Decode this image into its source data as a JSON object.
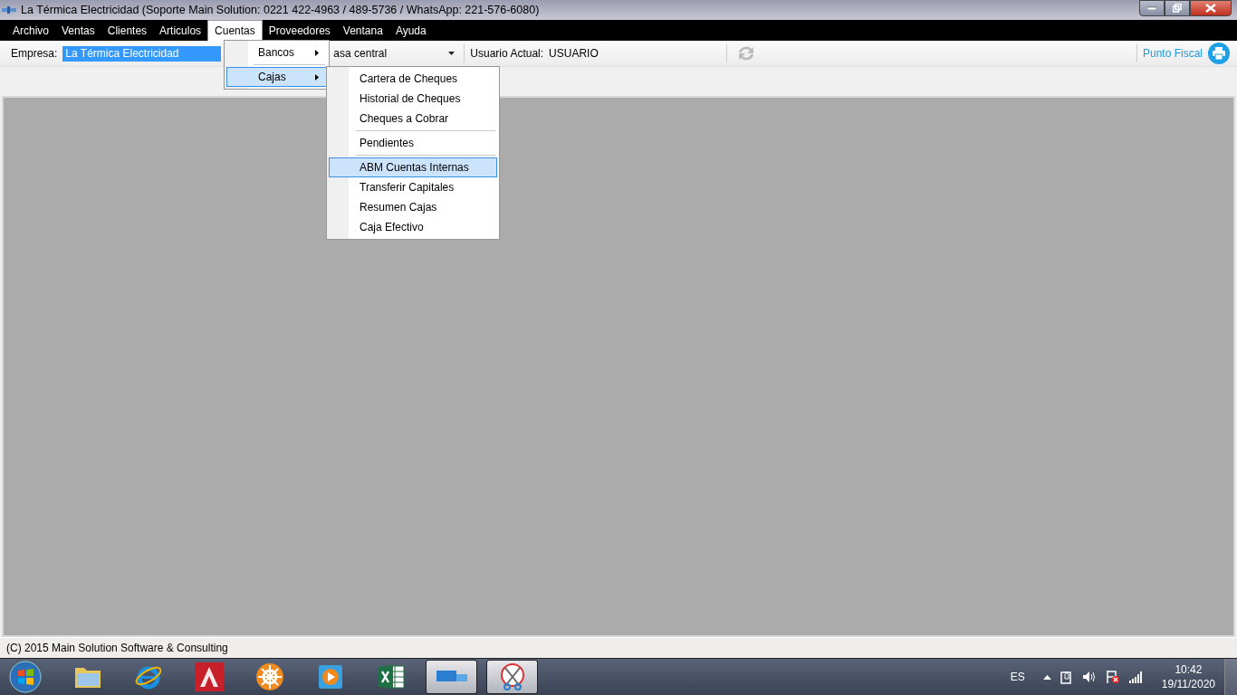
{
  "window": {
    "title": "La Térmica Electricidad (Soporte Main Solution: 0221 422-4963 / 489-5736 / WhatsApp: 221-576-6080)"
  },
  "menu": [
    {
      "label": "Archivo",
      "selected": false
    },
    {
      "label": "Ventas",
      "selected": false
    },
    {
      "label": "Clientes",
      "selected": false
    },
    {
      "label": "Articulos",
      "selected": false
    },
    {
      "label": "Cuentas",
      "selected": true
    },
    {
      "label": "Proveedores",
      "selected": false
    },
    {
      "label": "Ventana",
      "selected": false
    },
    {
      "label": "Ayuda",
      "selected": false
    }
  ],
  "toolbar": {
    "empresa_label": "Empresa:",
    "empresa_value": "La Térmica Electricidad",
    "sucursal_value": "asa central",
    "usuario_label": "Usuario Actual:",
    "usuario_value": "USUARIO",
    "punto_fiscal": "Punto Fiscal"
  },
  "cuentas_menu": [
    {
      "label": "Bancos",
      "selected": false
    },
    {
      "label": "Cajas",
      "selected": true
    }
  ],
  "cajas_menu": [
    {
      "label": "Cartera de Cheques",
      "selected": false,
      "separator_before": false
    },
    {
      "label": "Historial de Cheques",
      "selected": false,
      "separator_before": false
    },
    {
      "label": "Cheques a Cobrar",
      "selected": false,
      "separator_before": false
    },
    {
      "label": "Pendientes",
      "selected": false,
      "separator_before": true
    },
    {
      "label": "ABM Cuentas Internas",
      "selected": true,
      "separator_before": true
    },
    {
      "label": "Transferir Capitales",
      "selected": false,
      "separator_before": false
    },
    {
      "label": "Resumen Cajas",
      "selected": false,
      "separator_before": false
    },
    {
      "label": "Caja Efectivo",
      "selected": false,
      "separator_before": false
    }
  ],
  "status_bar": "(C) 2015 Main Solution Software & Consulting",
  "taskbar": {
    "apps": [
      {
        "kind": "folder",
        "selected": false
      },
      {
        "kind": "browser",
        "selected": false
      },
      {
        "kind": "cad",
        "selected": false
      },
      {
        "kind": "wheel",
        "selected": false
      },
      {
        "kind": "player",
        "selected": false
      },
      {
        "kind": "spreadsheet",
        "selected": false
      },
      {
        "kind": "comit",
        "selected": true
      },
      {
        "kind": "scissors",
        "selected": true
      }
    ],
    "language": "ES",
    "time": "10:42",
    "date": "19/11/2020"
  }
}
